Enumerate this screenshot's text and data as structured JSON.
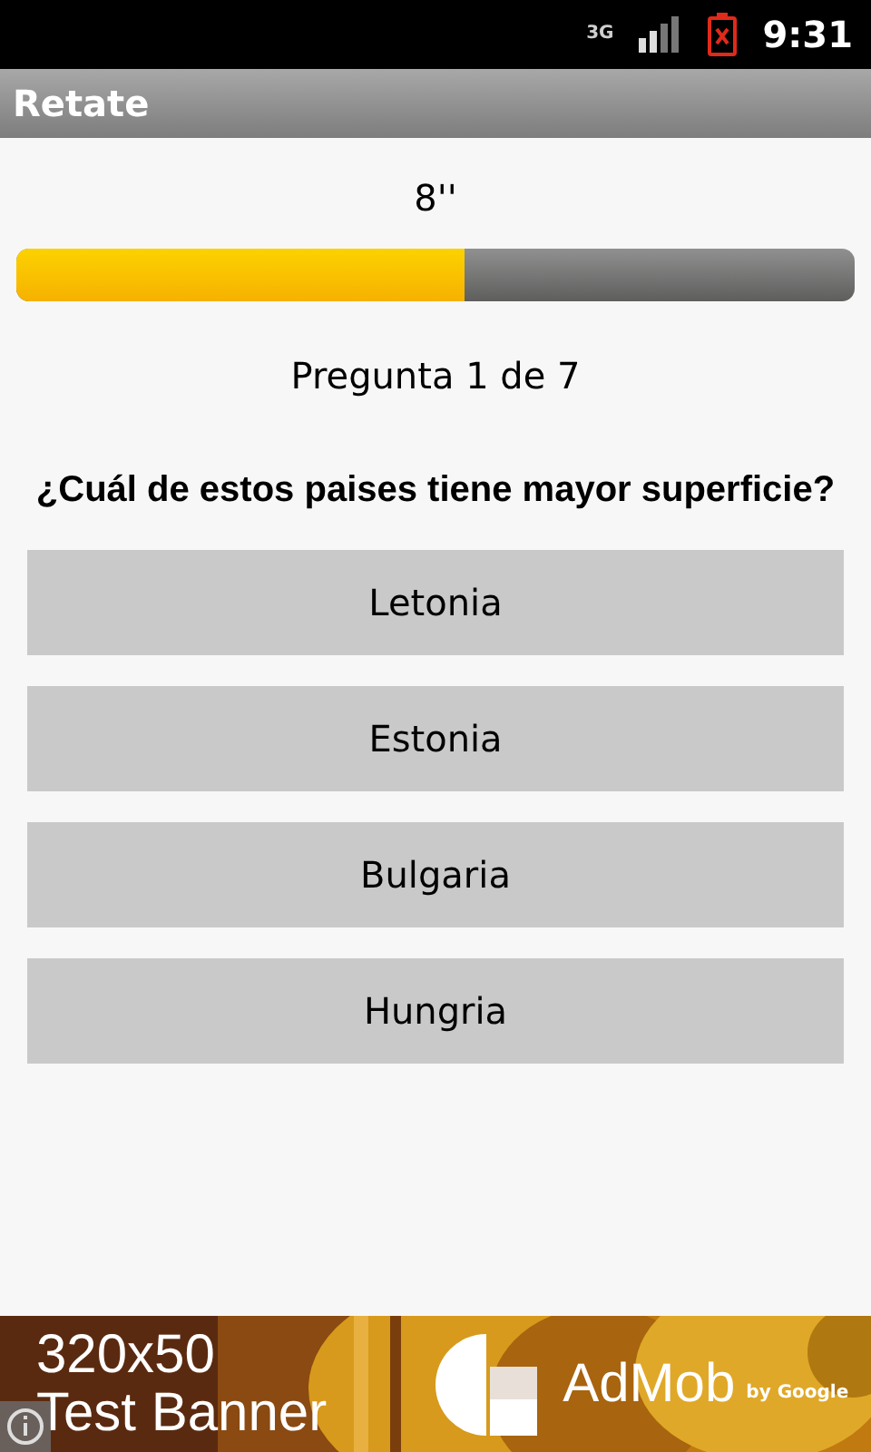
{
  "status_bar": {
    "network": "3G",
    "time": "9:31"
  },
  "app_bar": {
    "title": "Retate"
  },
  "timer": "8''",
  "progress": {
    "level": 0.535
  },
  "counter": "Pregunta 1 de 7",
  "question": "¿Cuál de estos paises tiene mayor superficie?",
  "answers": [
    "Letonia",
    "Estonia",
    "Bulgaria",
    "Hungria"
  ],
  "ad_banner": {
    "size": "320x50",
    "label": "Test Banner",
    "brand": "AdMob",
    "byline": "by Google"
  }
}
